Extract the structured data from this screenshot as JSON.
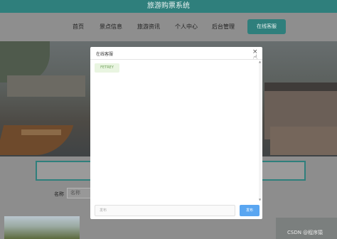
{
  "app": {
    "title": "旅游购票系统"
  },
  "nav": {
    "items": [
      {
        "label": "首页"
      },
      {
        "label": "景点信息"
      },
      {
        "label": "旅游资讯"
      },
      {
        "label": "个人中心"
      },
      {
        "label": "后台管理"
      }
    ],
    "cta_label": "在线客服"
  },
  "search": {
    "name_label": "名称",
    "name_placeholder": "名称"
  },
  "chat_modal": {
    "title": "在线客服",
    "close_symbol": "×",
    "messages": [
      {
        "text": "FETREY"
      }
    ],
    "input_placeholder": "发布",
    "send_label": "发布"
  },
  "watermark": "CSDN @程序猿",
  "colors": {
    "brand_teal": "#2f7f7c",
    "overlay_gray": "#8e8e8e",
    "send_blue": "#5aa6f1",
    "message_bubble": "#e9f5e1"
  }
}
